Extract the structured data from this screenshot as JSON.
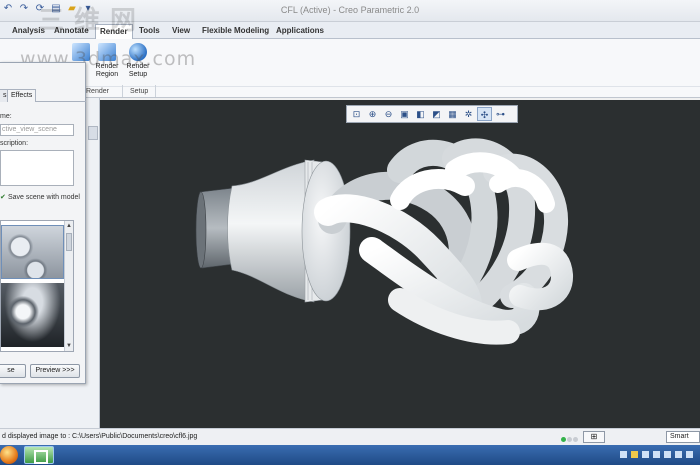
{
  "window": {
    "title": "CFL (Active) - Creo Parametric 2.0"
  },
  "watermark": {
    "cn_text": "三维网",
    "url": "www.3dmax.com"
  },
  "tabs": [
    "Analysis",
    "Annotate",
    "Render",
    "Tools",
    "View",
    "Flexible Modeling",
    "Applications"
  ],
  "ribbon": {
    "buttons": [
      {
        "label": "..."
      },
      {
        "label": "Render Region"
      },
      {
        "label": "Render Setup"
      }
    ],
    "groups": [
      "Render",
      "Setup"
    ]
  },
  "dialog": {
    "tabs": [
      "s",
      "Effects"
    ],
    "name_label": "me:",
    "name_value": "ctive_view_scene",
    "description_label": "scription:",
    "save_checkbox_label": "Save scene with model",
    "save_checked": true,
    "close_button": "se",
    "preview_button": "Preview >>>"
  },
  "viewport_toolbar": {
    "tools": [
      "zoom-fit-icon",
      "zoom-in-icon",
      "zoom-out-icon",
      "repaint-icon",
      "display-style-icon",
      "saved-views-icon",
      "view-manager-icon",
      "perspective-icon",
      "spin-center-icon",
      "annotation-display-icon"
    ]
  },
  "status": {
    "message": "d displayed image to : C:\\Users\\Public\\Documents\\creo\\cfl6.jpg",
    "filter_label": "Smart"
  },
  "colors": {
    "viewport_bg": "#2b2f30",
    "accent": "#2a6fc4",
    "status_ok": "#34b24a"
  }
}
